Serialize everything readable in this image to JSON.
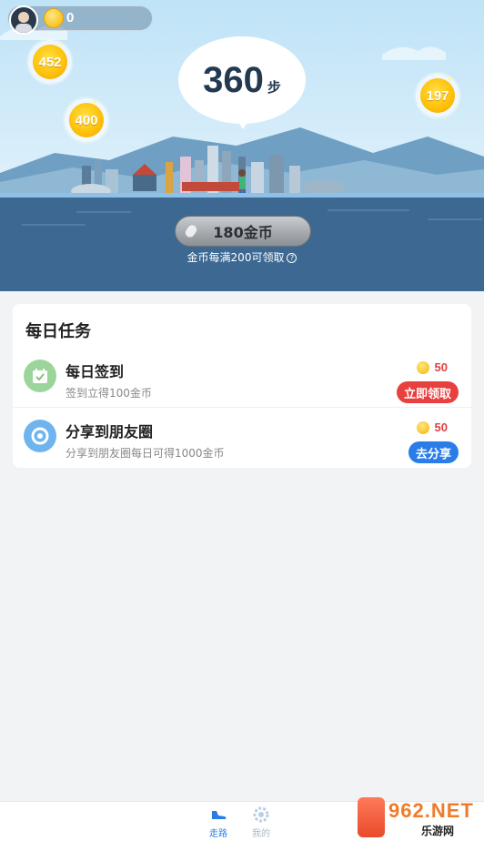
{
  "header": {
    "coin_balance": "0",
    "avatar_icon": "user-avatar-icon"
  },
  "bubbles": {
    "b1": "452",
    "b2": "400",
    "b3": "197"
  },
  "steps": {
    "value": "360",
    "unit": "步"
  },
  "claim": {
    "button_label": "180金币",
    "hint": "金币每满200可领取"
  },
  "tasks": {
    "title": "每日任务",
    "items": [
      {
        "name": "每日签到",
        "desc": "签到立得100金币",
        "reward": "50",
        "button": "立即领取",
        "icon": "calendar-check-icon",
        "button_color": "#e8403e"
      },
      {
        "name": "分享到朋友圈",
        "desc": "分享到朋友圈每日可得1000金币",
        "reward": "50",
        "button": "去分享",
        "icon": "camera-aperture-icon",
        "button_color": "#2a7de8"
      }
    ]
  },
  "bottom_nav": {
    "items": [
      {
        "label": "走路",
        "icon": "shoe-icon",
        "active": true
      },
      {
        "label": "我的",
        "icon": "gear-icon",
        "active": false
      }
    ]
  },
  "watermark": {
    "text": "962.NET",
    "sub": "乐游网"
  },
  "colors": {
    "accent_red": "#e8403e",
    "accent_blue": "#2a7de8",
    "sea": "#3d6891",
    "coin_gold": "#ffc20a"
  }
}
